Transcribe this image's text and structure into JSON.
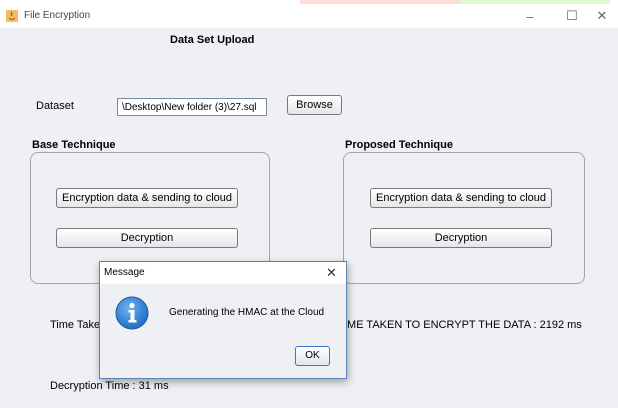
{
  "window": {
    "title": "File Encryption",
    "controls": {
      "minimize": "–",
      "maximize": "☐",
      "close": "✕"
    }
  },
  "upload": {
    "heading": "Data Set Upload",
    "dataset_label": "Dataset",
    "dataset_path": "\\Desktop\\New folder (3)\\27.sql",
    "browse_label": "Browse"
  },
  "base": {
    "heading": "Base Technique",
    "encrypt_label": "Encryption data & sending to cloud",
    "decrypt_label": "Decryption"
  },
  "proposed": {
    "heading": "Proposed Technique",
    "encrypt_label": "Encryption data & sending to cloud",
    "decrypt_label": "Decryption"
  },
  "results": {
    "time_taken_partial": "Time Taken",
    "encrypt_time_partial": "IME TAKEN TO ENCRYPT THE DATA : 2192 ms",
    "decryption_time": "Decryption Time  : 31 ms"
  },
  "dialog": {
    "title": "Message",
    "close": "✕",
    "message": "Generating the HMAC  at the Cloud",
    "ok_label": "OK"
  },
  "colors": {
    "accent": "#3b79c7",
    "info_icon": "#1f6fc4"
  }
}
